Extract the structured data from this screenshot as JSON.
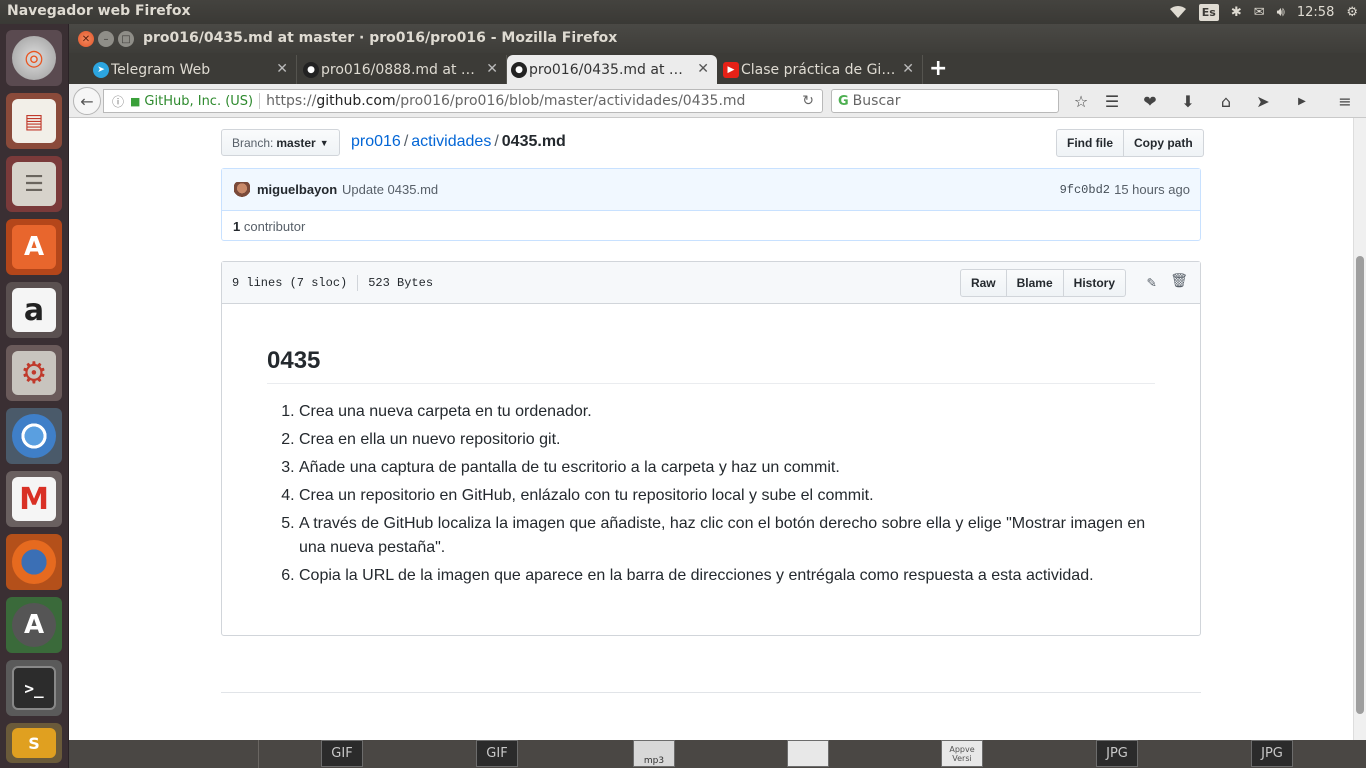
{
  "panel": {
    "app_title": "Navegador web Firefox",
    "lang": "Es",
    "clock": "12:58"
  },
  "window": {
    "title": "pro016/0435.md at master · pro016/pro016 - Mozilla Firefox"
  },
  "tabs": [
    {
      "label": "Telegram Web",
      "icon": "telegram-icon",
      "color": "#2ca5e0"
    },
    {
      "label": "pro016/0888.md at …",
      "icon": "github-icon",
      "color": "#222222"
    },
    {
      "label": "pro016/0435.md at …",
      "icon": "github-icon",
      "color": "#222222",
      "active": true
    },
    {
      "label": "Clase práctica de Gi…",
      "icon": "youtube-icon",
      "color": "#e62117"
    }
  ],
  "navbar": {
    "identity": "GitHub, Inc. (US)",
    "url_prefix": "https://",
    "url_host": "github.com",
    "url_path": "/pro016/pro016/blob/master/actividades/0435.md",
    "search_placeholder": "Buscar"
  },
  "repo": {
    "branch_label": "Branch:",
    "branch_name": "master",
    "breadcrumb_root": "pro016",
    "breadcrumb_dir": "actividades",
    "breadcrumb_file": "0435.md",
    "find_file": "Find file",
    "copy_path": "Copy path"
  },
  "commit": {
    "author": "miguelbayon",
    "message": "Update 0435.md",
    "sha": "9fc0bd2",
    "time": "15 hours ago",
    "contributors_count": "1",
    "contributors_label": "contributor"
  },
  "file": {
    "lines": "9 lines (7 sloc)",
    "size": "523 Bytes",
    "raw": "Raw",
    "blame": "Blame",
    "history": "History"
  },
  "markdown": {
    "heading": "0435",
    "items": [
      "Crea una nueva carpeta en tu ordenador.",
      "Crea en ella un nuevo repositorio git.",
      "Añade una captura de pantalla de tu escritorio a la carpeta y haz un commit.",
      "Crea un repositorio en GitHub, enlázalo con tu repositorio local y sube el commit.",
      "A través de GitHub localiza la imagen que añadiste, haz clic con el botón derecho sobre ella y elige \"Mostrar imagen en una nueva pestaña\".",
      "Copia la URL de la imagen que aparece en la barra de direcciones y entrégala como respuesta a esta actividad."
    ]
  },
  "desktop_files": [
    "GIF",
    "GIF",
    "mp3",
    "Appve Versi",
    "JPG",
    "JPG"
  ]
}
